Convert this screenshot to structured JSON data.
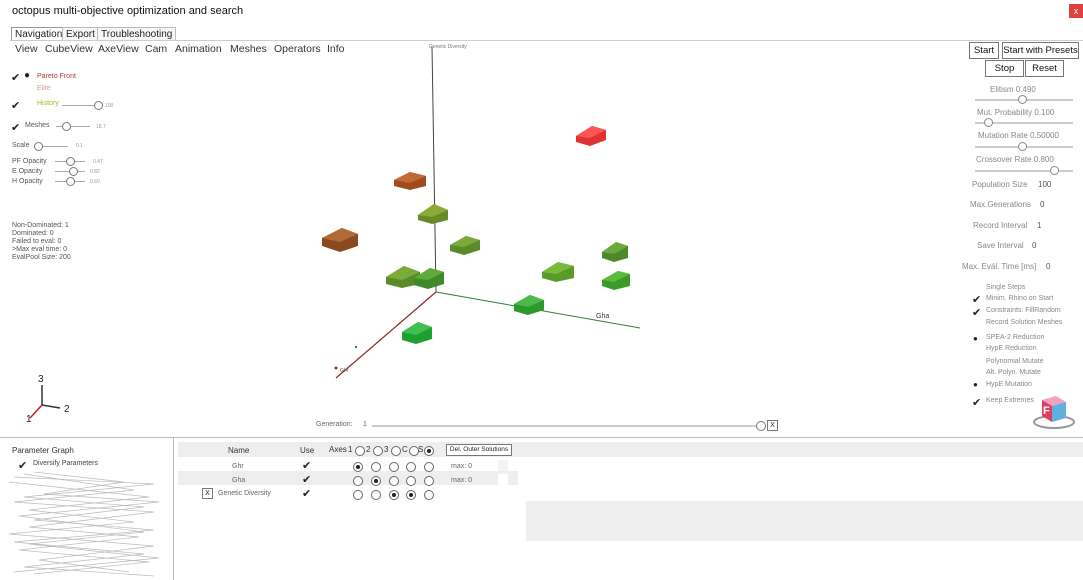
{
  "window": {
    "title": "octopus multi-objective optimization and search",
    "close": "x"
  },
  "tabs": [
    {
      "label": "Navigation"
    },
    {
      "label": "Export"
    },
    {
      "label": "Troubleshooting"
    }
  ],
  "menu": [
    "View",
    "CubeView",
    "AxeView",
    "Cam",
    "Animation",
    "Meshes",
    "Operators",
    "Info"
  ],
  "left": {
    "pareto_front": "Pareto Front",
    "elite": "Elite",
    "history": "History",
    "history_val": "100",
    "meshes": "Meshes",
    "meshes_val": "18.7",
    "scale": "Scale",
    "scale_val": "0.1",
    "pf_opacity": "PF Opacity",
    "pf_opacity_val": "0.47",
    "e_opacity": "E Opacity",
    "e_opacity_val": "0.82",
    "h_opacity": "H Opacity",
    "h_opacity_val": "0.60",
    "stats": [
      "Non-Dominated: 1",
      "Dominated: 0",
      "Failed to eval: 0",
      ">Max eval time: 0",
      "EvalPool Size: 200"
    ],
    "colors": {
      "pareto": "#c0392b",
      "elite": "#d98c8c",
      "history": "#b8b820"
    }
  },
  "viewport": {
    "axis_y": "Genetic Diversity",
    "axis_x": "Gha",
    "axis_z": "Ghr",
    "generation_label": "Generation:",
    "generation_value": "1",
    "gizmo": [
      "3",
      "2",
      "1"
    ]
  },
  "right": {
    "start": "Start",
    "start_presets": "Start with Presets",
    "stop": "Stop",
    "reset": "Reset",
    "elitism": "Elitism 0.490",
    "mut_prob": "Mut. Probability 0.100",
    "mut_rate": "Mutation Rate 0.50000",
    "crossover": "Crossover Rate 0.800",
    "population": "Population Size",
    "population_val": "100",
    "max_gen": "Max.Generations",
    "max_gen_val": "0",
    "record_interval": "Record Interval",
    "record_interval_val": "1",
    "save_interval": "Save Interval",
    "save_interval_val": "0",
    "max_eval": "Max. Evál. Time [ms]",
    "max_eval_val": "0",
    "options": [
      "Single Steps",
      "Minim. Rhino on Start",
      "Constraints: FillRandom",
      "Record Solution Meshes",
      "SPEA-2 Reduction",
      "HypE Reduction",
      "Polynomial Mutate",
      "Alt. Polyn. Mutate",
      "HypE Mutation",
      "Keep Extremes"
    ],
    "logo_letter": "F"
  },
  "bottom": {
    "param_graph": "Parameter Graph",
    "diversify": "Diversify Parameters",
    "col_name": "Name",
    "col_use": "Use",
    "col_axes": "Axes",
    "axes_labels": [
      "1",
      "2",
      "3",
      "C",
      "S"
    ],
    "del_outer": "Del. Outer Solutions",
    "rows": [
      {
        "name": "Ghr",
        "max": "max: 0"
      },
      {
        "name": "Gha",
        "max": "max: 0"
      },
      {
        "name": "Genetic Diversity",
        "max": ""
      }
    ],
    "x_box": "X"
  }
}
